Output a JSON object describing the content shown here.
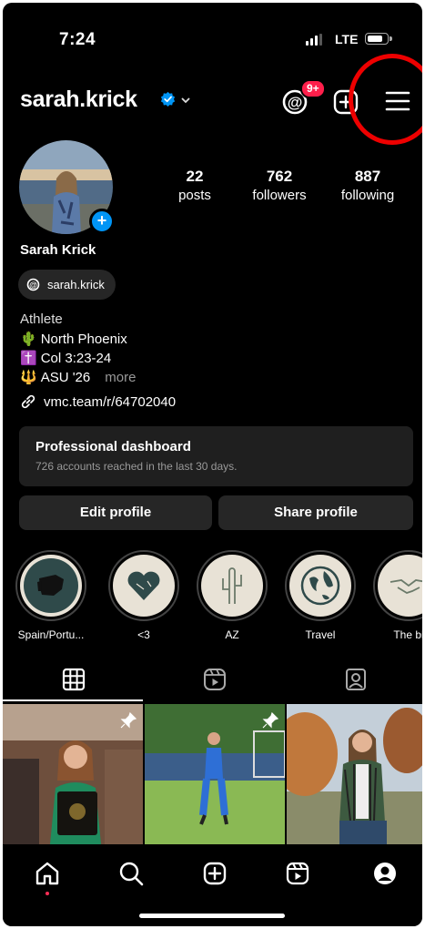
{
  "status_bar": {
    "time": "7:24",
    "network": "LTE"
  },
  "header": {
    "username": "sarah.krick",
    "notification_count": "9+"
  },
  "profile": {
    "name": "Sarah Krick",
    "stats": [
      {
        "value": "22",
        "label": "posts"
      },
      {
        "value": "762",
        "label": "followers"
      },
      {
        "value": "887",
        "label": "following"
      }
    ],
    "threads_handle": "sarah.krick",
    "bio": {
      "category": "Athlete",
      "lines": [
        {
          "emoji": "🌵",
          "text": "North Phoenix"
        },
        {
          "emoji": "✝️",
          "text": "Col 3:23-24"
        },
        {
          "emoji": "🔱",
          "text": "ASU '26"
        }
      ],
      "more_label": "more"
    },
    "link": "vmc.team/r/64702040"
  },
  "dashboard": {
    "title": "Professional dashboard",
    "subtitle": "726 accounts reached in the last 30 days."
  },
  "buttons": {
    "edit_profile": "Edit profile",
    "share_profile": "Share profile"
  },
  "highlights": [
    {
      "label": "Spain/Portu...",
      "icon": "spain-map-icon"
    },
    {
      "label": "<3",
      "icon": "heart-icon"
    },
    {
      "label": "AZ",
      "icon": "cactus-icon"
    },
    {
      "label": "Travel",
      "icon": "globe-icon"
    },
    {
      "label": "The bi",
      "icon": "handshake-icon"
    }
  ],
  "tabs": [
    "grid-icon",
    "reels-icon",
    "tagged-icon"
  ],
  "nav": [
    "home-icon",
    "search-icon",
    "create-icon",
    "reels-icon",
    "profile-icon"
  ],
  "colors": {
    "accent": "#0095f6",
    "badge": "#ff1f4b",
    "annotation": "#e00000"
  }
}
